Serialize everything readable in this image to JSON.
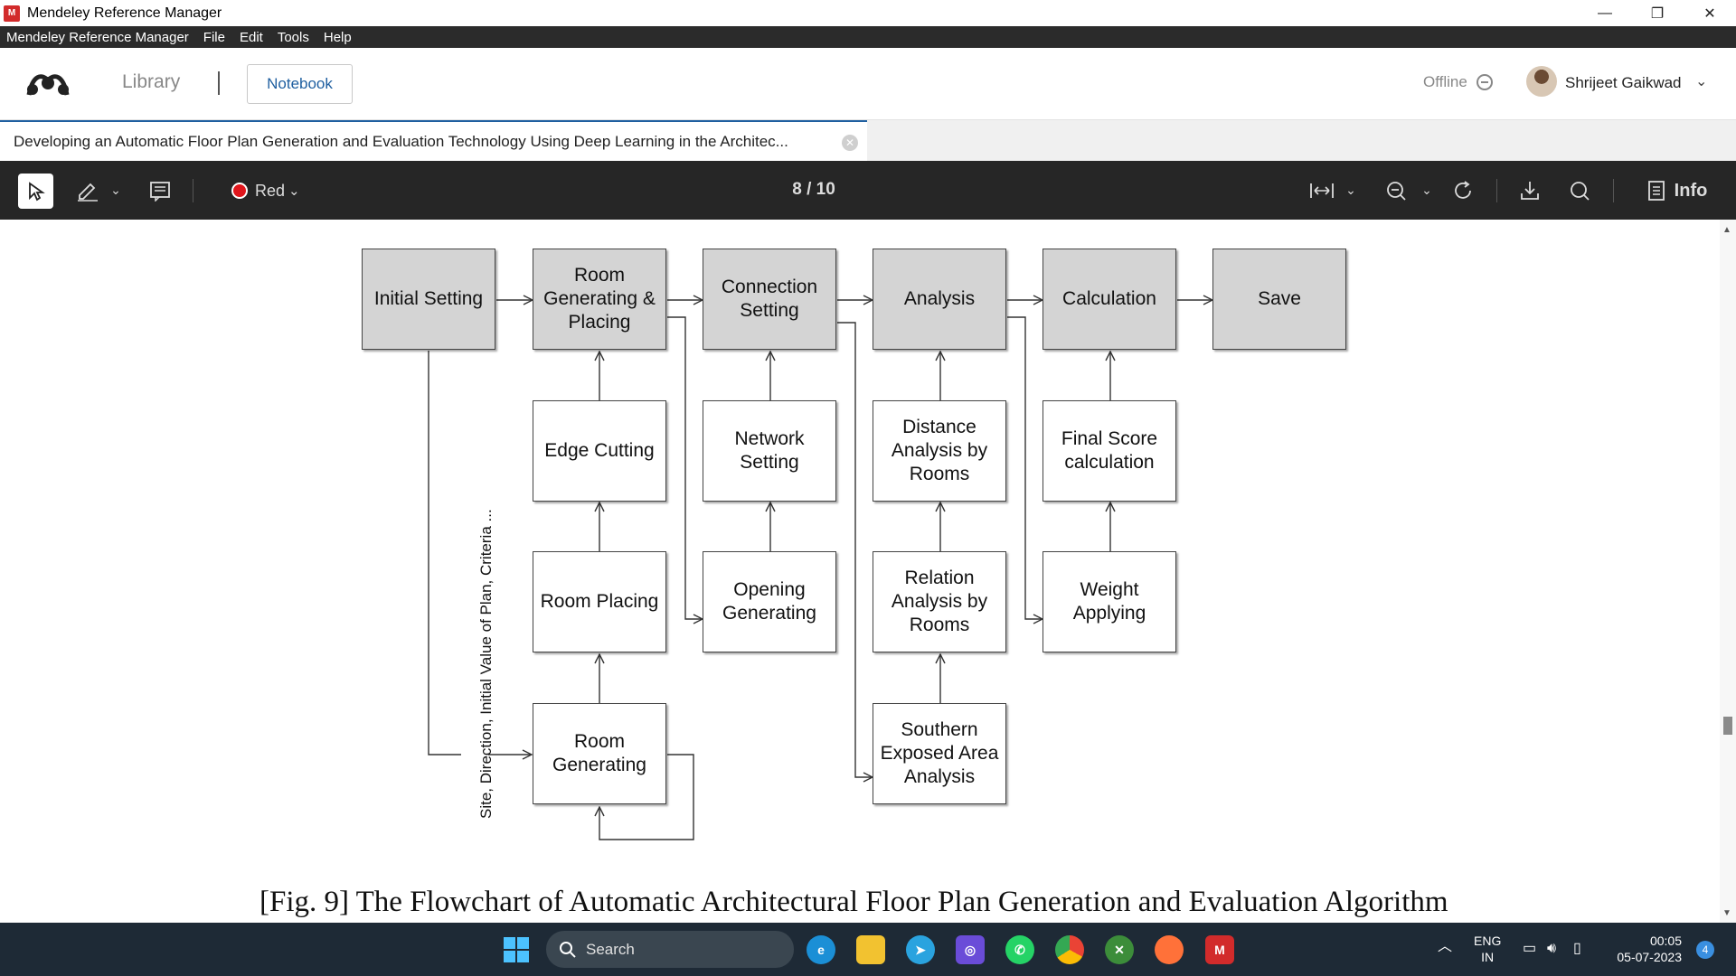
{
  "window": {
    "title": "Mendeley Reference Manager",
    "minimize": "—",
    "restore": "❐",
    "close": "✕"
  },
  "menu": [
    "Mendeley Reference Manager",
    "File",
    "Edit",
    "Tools",
    "Help"
  ],
  "header": {
    "library": "Library",
    "notebook": "Notebook",
    "status": "Offline",
    "user": "Shrijeet Gaikwad"
  },
  "tab": {
    "title": "Developing an Automatic Floor Plan Generation and Evaluation Technology Using Deep Learning in the Architec..."
  },
  "toolbar": {
    "color_label": "Red",
    "page": "8 / 10",
    "info_label": "Info"
  },
  "diagram": {
    "top_row": [
      "Initial Setting",
      "Room Generating & Placing",
      "Connection Setting",
      "Analysis",
      "Calculation",
      "Save"
    ],
    "row2": [
      "Edge Cutting",
      "Network Setting",
      "Distance Analysis by Rooms",
      "Final Score calculation"
    ],
    "row3": [
      "Room Placing",
      "Opening Generating",
      "Relation Analysis by Rooms",
      "Weight Applying"
    ],
    "row4": [
      "Room Generating",
      "Southern Exposed Area Analysis"
    ],
    "vertical_label": "Site, Direction, Initial Value of Plan, Criteria ...",
    "caption": "[Fig. 9] The Flowchart of Automatic Architectural Floor Plan Generation and Evaluation Algorithm"
  },
  "taskbar": {
    "search": "Search",
    "lang_1": "ENG",
    "lang_2": "IN",
    "time": "00:05",
    "date": "05-07-2023",
    "notifications": "4"
  }
}
